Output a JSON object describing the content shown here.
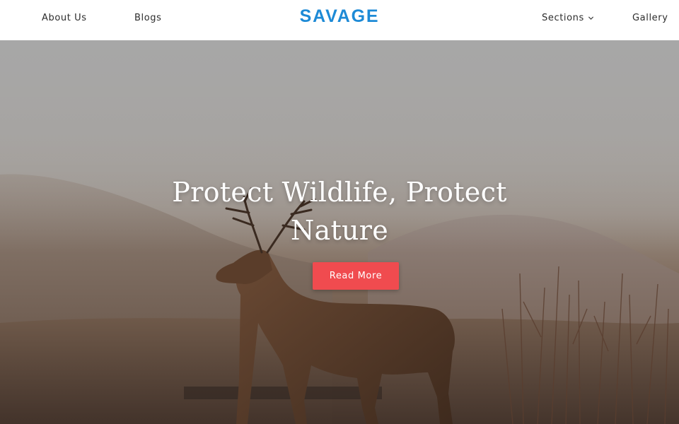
{
  "brand": {
    "name": "SAVAGE",
    "color": "#1d8ad6"
  },
  "nav": {
    "left": [
      {
        "label": "About Us"
      },
      {
        "label": "Blogs"
      }
    ],
    "right": [
      {
        "label": "Sections",
        "icon": "chevron-down-icon"
      },
      {
        "label": "Gallery"
      }
    ]
  },
  "hero": {
    "image": "deer-stag-in-misty-highlands",
    "title": "Protect Wildlife, Protect Nature",
    "cta_label": "Read More",
    "cta_color": "#f04b4f"
  }
}
